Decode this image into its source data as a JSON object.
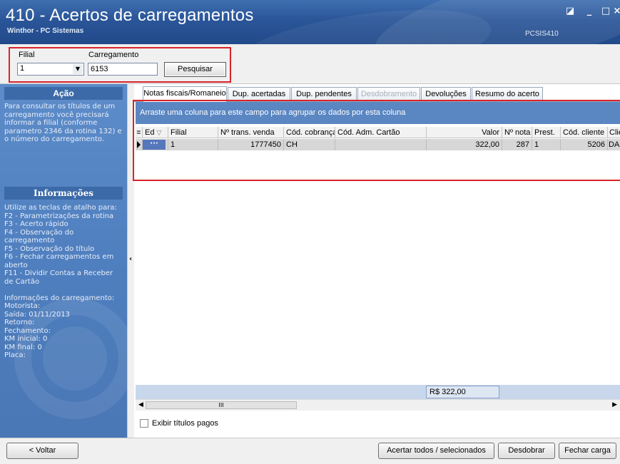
{
  "window": {
    "title": "410 - Acertos de carregamentos",
    "subtitle": "Winthor - PC Sistemas",
    "code": "PCSIS410",
    "controls": {
      "restore": "◪",
      "minimize": "_",
      "maximize": "□",
      "close": "×"
    }
  },
  "filter": {
    "filial_label": "Filial",
    "filial_value": "1",
    "carregamento_label": "Carregamento",
    "carregamento_value": "6153",
    "search_button": "Pesquisar"
  },
  "left_panel": {
    "acao_title": "Ação",
    "acao_text": "Para consultar os títulos de um\ncarregamento você precisará\ninformar a filial (conforme\nparametro 2346 da rotina 132) e\no número do carregamento.",
    "info_title": "Informações",
    "info_text": "Utilize as teclas de atalho para:\nF2 - Parametrizações da rotina\nF3 - Acerto rápido\nF4 - Observação do\ncarregamento\nF5 - Observação do título\nF6 - Fechar carregamentos em\naberto\nF11 - Dividir Contas a Receber\nde Cartão\n\nInformações do carregamento:\nMotorista:\nSaída: 01/11/2013\nRetorno:\nFechamento:\nKM inicial: 0\nKM final: 0\nPlaca:"
  },
  "tabs": [
    {
      "label": "Notas fiscais/Romaneio"
    },
    {
      "label": "Dup. acertadas"
    },
    {
      "label": "Dup. pendentes"
    },
    {
      "label": "Desdobramento"
    },
    {
      "label": "Devoluções"
    },
    {
      "label": "Resumo do acerto"
    }
  ],
  "grid": {
    "group_hint": "Arraste uma coluna para este campo para agrupar os dados por esta coluna",
    "columns": [
      "Ed",
      "Filial",
      "Nº trans. venda",
      "Cód. cobrança",
      "Cód. Adm. Cartão",
      "Valor",
      "Nº nota",
      "Prest.",
      "Cód. cliente",
      "Cliente"
    ],
    "rows": [
      {
        "ed": "···",
        "filial": "1",
        "trans_venda": "1777450",
        "cobranca": "CH",
        "adm_cartao": "",
        "valor": "322,00",
        "nota": "287",
        "prest": "1",
        "cod_cliente": "5206",
        "cliente": "DANIEL"
      }
    ],
    "total": "R$ 322,00",
    "scroll_thumb": "III"
  },
  "options": {
    "show_paid_label": "Exibir títulos pagos"
  },
  "bottom": {
    "back": "< Voltar",
    "settle_all": "Acertar todos / selecionados",
    "split": "Desdobrar",
    "close_load": "Fechar carga"
  },
  "colors": {
    "title_blue": "#2a5598",
    "panel_blue": "#4f7fbf",
    "highlight_red": "#d9232a"
  }
}
